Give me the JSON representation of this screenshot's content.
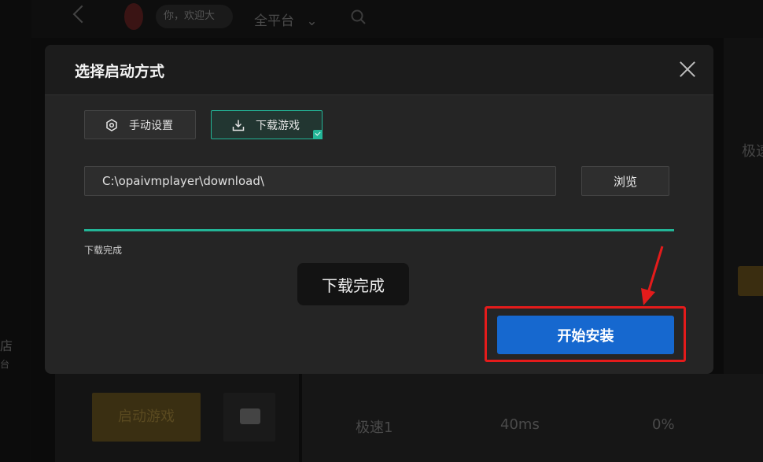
{
  "background": {
    "search_text": "你，欢迎大",
    "platform_label": "全平台",
    "left_label_1": "店",
    "left_label_2": "台",
    "right_label": "极速",
    "start_game_label": "启动游戏",
    "speed_label": "极速1",
    "ping_label": "40ms",
    "loss_label": "0%"
  },
  "modal": {
    "title": "选择启动方式",
    "options": [
      {
        "label": "手动设置",
        "icon": "settings-icon",
        "selected": false
      },
      {
        "label": "下载游戏",
        "icon": "download-icon",
        "selected": true
      }
    ],
    "path_value": "C:\\opaivmplayer\\download\\",
    "browse_label": "浏览",
    "progress": 1.0,
    "progress_status": "下载完成",
    "toast_text": "下载完成",
    "install_label": "开始安装"
  },
  "colors": {
    "accent_teal": "#23b597",
    "install_blue": "#1668cf",
    "highlight_red": "#e41b1b"
  }
}
